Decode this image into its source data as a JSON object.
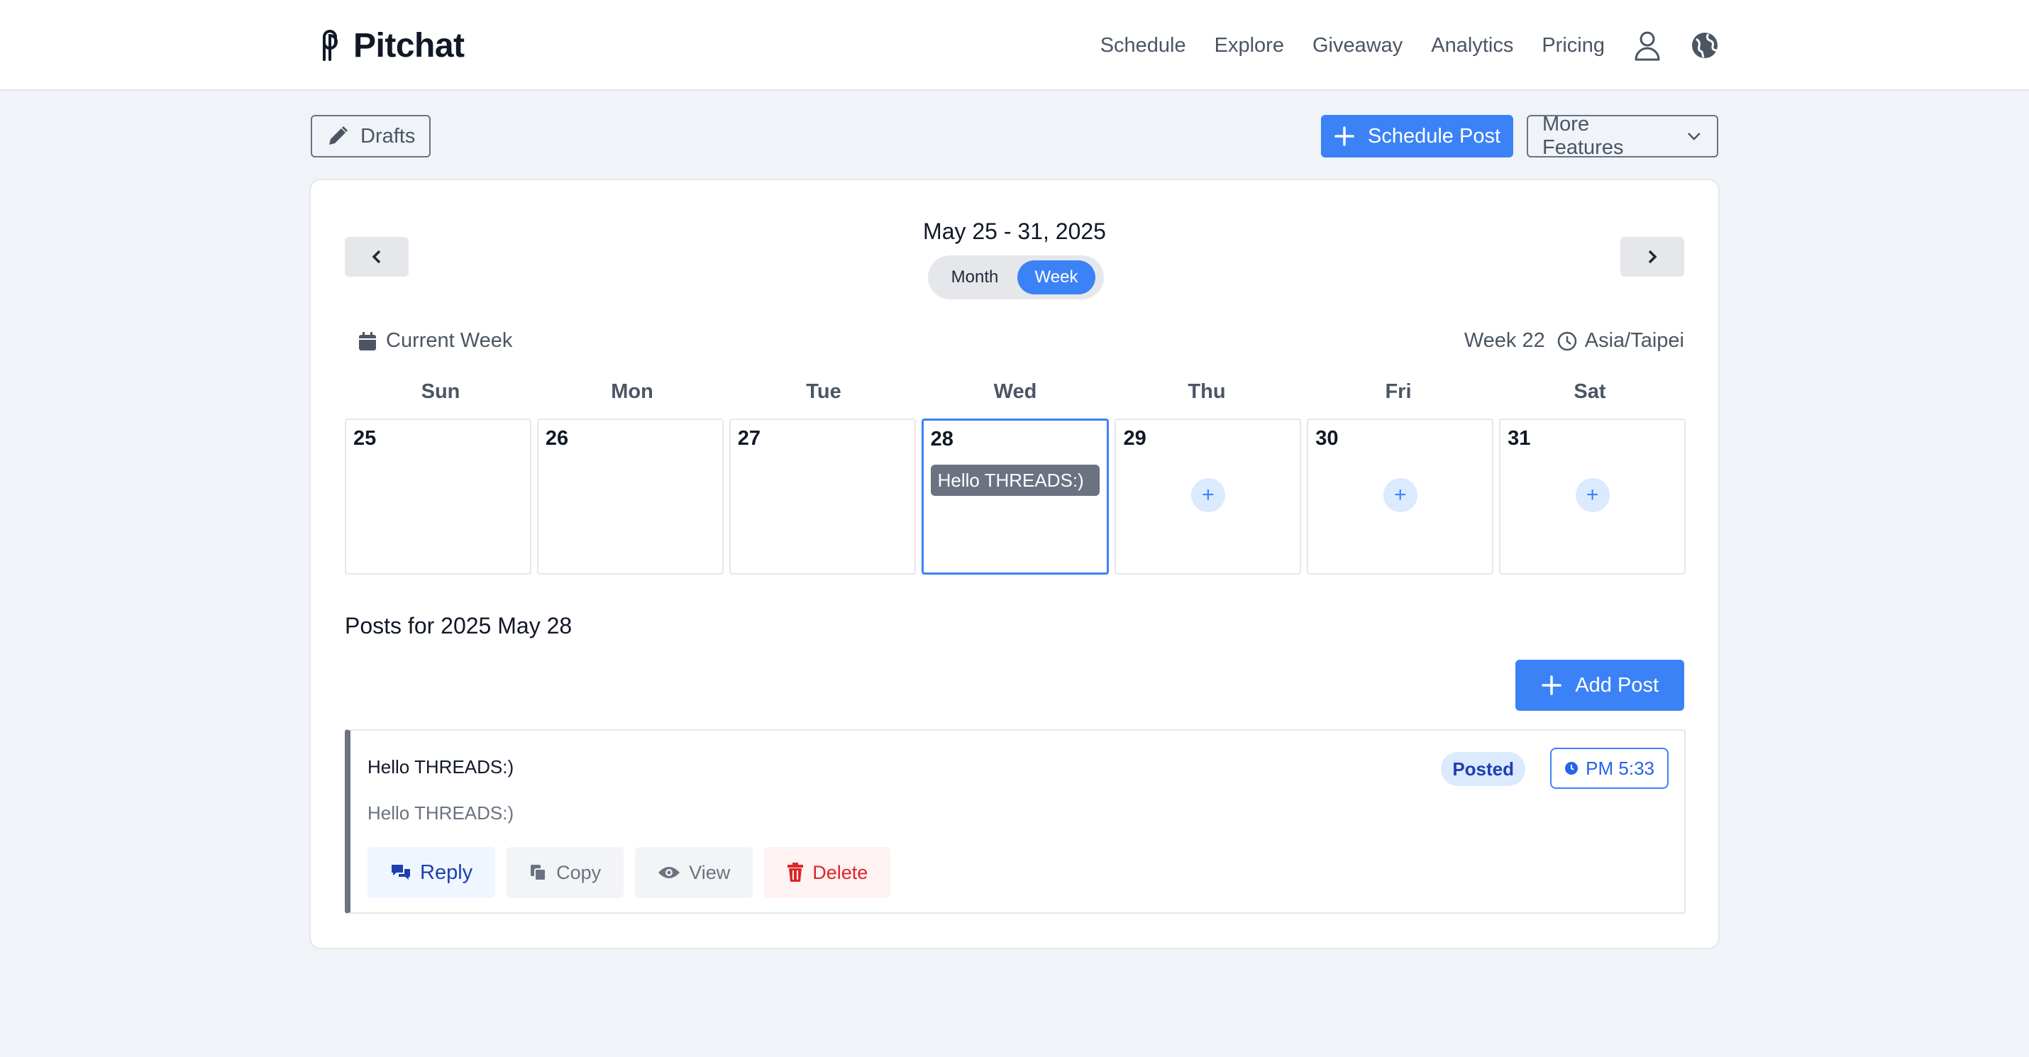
{
  "app": {
    "name": "Pitchat"
  },
  "nav": {
    "links": [
      "Schedule",
      "Explore",
      "Giveaway",
      "Analytics",
      "Pricing"
    ],
    "icons": [
      "user-icon",
      "globe-icon"
    ]
  },
  "toolbar": {
    "drafts_label": "Drafts",
    "schedule_post_label": "Schedule Post",
    "more_features_label": "More Features"
  },
  "calendar": {
    "range_title": "May 25 - 31, 2025",
    "view_options": {
      "month": "Month",
      "week": "Week",
      "selected": "Week"
    },
    "current_week_label": "Current Week",
    "week_label": "Week 22",
    "timezone": "Asia/Taipei",
    "day_headers": [
      "Sun",
      "Mon",
      "Tue",
      "Wed",
      "Thu",
      "Fri",
      "Sat"
    ],
    "days": [
      {
        "num": "25",
        "event": null,
        "add": false
      },
      {
        "num": "26",
        "event": null,
        "add": false
      },
      {
        "num": "27",
        "event": null,
        "add": false
      },
      {
        "num": "28",
        "event": "Hello THREADS:)",
        "add": false,
        "selected": true
      },
      {
        "num": "29",
        "event": null,
        "add": true
      },
      {
        "num": "30",
        "event": null,
        "add": true
      },
      {
        "num": "31",
        "event": null,
        "add": true
      }
    ],
    "add_symbol": "+"
  },
  "posts": {
    "title": "Posts for 2025 May 28",
    "add_post_label": "Add Post",
    "items": [
      {
        "title": "Hello THREADS:)",
        "body": "Hello THREADS:)",
        "status": "Posted",
        "time": "PM 5:33",
        "actions": {
          "reply": "Reply",
          "copy": "Copy",
          "view": "View",
          "delete": "Delete"
        }
      }
    ]
  },
  "colors": {
    "accent": "#3b82f6",
    "danger": "#dc2626",
    "background": "#f0f3f8"
  }
}
